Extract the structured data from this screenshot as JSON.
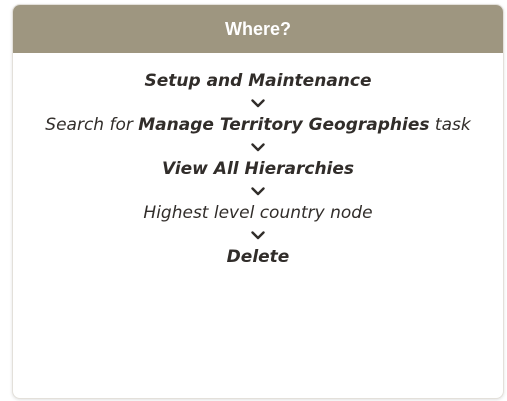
{
  "colors": {
    "header_bg": "#9e9680",
    "text": "#312d2a"
  },
  "header": {
    "title": "Where?"
  },
  "steps": [
    {
      "bold": "Setup and Maintenance"
    },
    {
      "prefix": "Search for ",
      "bold": "Manage Territory Geographies",
      "suffix": " task"
    },
    {
      "bold": "View All Hierarchies"
    },
    {
      "plain": "Highest level country node"
    },
    {
      "bold": "Delete"
    }
  ],
  "icons": {
    "separator": "chevron-down-icon"
  }
}
